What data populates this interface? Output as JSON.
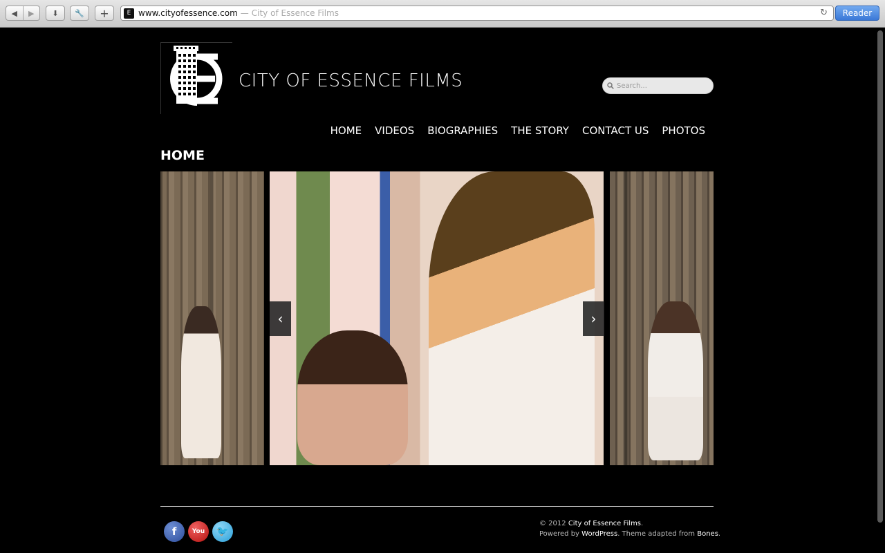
{
  "browser": {
    "url": "www.cityofessence.com",
    "separator": "—",
    "page_title": "City of Essence Films",
    "reader_label": "Reader"
  },
  "site": {
    "title": "CITY OF ESSENCE FILMS",
    "search_placeholder": "Search..."
  },
  "nav": {
    "items": [
      {
        "label": "HOME"
      },
      {
        "label": "VIDEOS"
      },
      {
        "label": "BIOGRAPHIES"
      },
      {
        "label": "THE STORY"
      },
      {
        "label": "CONTACT US"
      },
      {
        "label": "PHOTOS"
      }
    ]
  },
  "page": {
    "heading": "HOME"
  },
  "slider": {
    "prev_icon": "chevron-left-icon",
    "next_icon": "chevron-right-icon"
  },
  "footer": {
    "copyright": "© 2012",
    "site_link": "City of Essence Films",
    "powered_by": "Powered by",
    "wordpress": "WordPress",
    "theme_text": ". Theme adapted from",
    "bones": "Bones",
    "period": "."
  },
  "social": [
    "facebook-icon",
    "youtube-icon",
    "twitter-icon"
  ]
}
